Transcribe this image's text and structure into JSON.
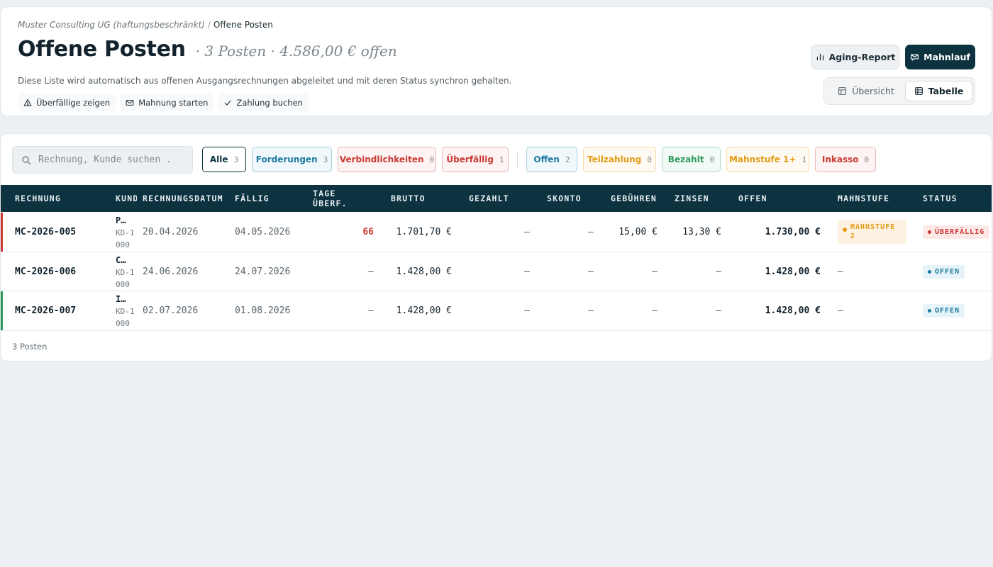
{
  "breadcrumb": {
    "company": "Muster Consulting UG (haftungsbeschränkt)",
    "separator": "/",
    "current": "Offene Posten"
  },
  "page": {
    "title": "Offene Posten",
    "summary": "· 3 Posten · 4.586,00 € offen",
    "description": "Diese Liste wird automatisch aus offenen Ausgangsrechnungen abgeleitet und mit deren Status synchron gehalten."
  },
  "quick_actions": [
    {
      "label": "Überfällige zeigen",
      "icon": "warning-icon"
    },
    {
      "label": "Mahnung starten",
      "icon": "mail-icon"
    },
    {
      "label": "Zahlung buchen",
      "icon": "check-icon"
    }
  ],
  "toolbar": {
    "aging_label": "Aging-Report",
    "mahnlauf_label": "Mahnlauf"
  },
  "view_toggle": {
    "overview_label": "Übersicht",
    "table_label": "Tabelle",
    "selected": "Tabelle"
  },
  "search": {
    "placeholder": "Rechnung, Kunde suchen .",
    "value": ""
  },
  "filters": [
    {
      "label": "Alle",
      "count": "3",
      "color": "#0d3340",
      "bg": "#ffffff",
      "active": true
    },
    {
      "label": "Forderungen",
      "count": "3",
      "color": "#1b7aa0",
      "bg": "#f1f8fb"
    },
    {
      "label": "Verbindlichkeiten",
      "count": "0",
      "color": "#c93a33",
      "bg": "#fdf3f3"
    },
    {
      "label": "Überfällig",
      "count": "1",
      "color": "#c93a33",
      "bg": "#fdf3f3"
    },
    {
      "label": "Offen",
      "count": "2",
      "color": "#1b7aa0",
      "bg": "#f1f8fb"
    },
    {
      "label": "Teilzahlung",
      "count": "0",
      "color": "#e39b17",
      "bg": "#fffaf1"
    },
    {
      "label": "Bezahlt",
      "count": "0",
      "color": "#2e9a5a",
      "bg": "#f2faf5"
    },
    {
      "label": "Mahnstufe 1+",
      "count": "1",
      "color": "#e39b17",
      "bg": "#fffaf1"
    },
    {
      "label": "Inkasso",
      "count": "0",
      "color": "#c93a33",
      "bg": "#fdf3f3"
    }
  ],
  "table": {
    "columns": [
      "RECHNUNG",
      "KUNDE",
      "RECHNUNGSDATUM",
      "FÄLLIG",
      "TAGE ÜBERF.",
      "BRUTTO",
      "GEZAHLT",
      "SKONTO",
      "GEBÜHREN",
      "ZINSEN",
      "OFFEN",
      "MAHNSTUFE",
      "STATUS"
    ],
    "rows": [
      {
        "rechnung": "MC-2026-005",
        "kunde": "P…",
        "kunde_nr": "KD-1000",
        "datum": "20.04.2026",
        "faellig": "04.05.2026",
        "tage": "66",
        "brutto": "1.701,70 €",
        "gezahlt": "–",
        "skonto": "–",
        "gebuehren": "15,00 €",
        "zinsen": "13,30 €",
        "offen": "1.730,00 €",
        "mahnstufe": "MAHNSTUFE 2",
        "status": "ÜBERFÄLLIG",
        "status_type": "overdue",
        "accent": "#c93a33"
      },
      {
        "rechnung": "MC-2026-006",
        "kunde": "C…",
        "kunde_nr": "KD-1000",
        "datum": "24.06.2026",
        "faellig": "24.07.2026",
        "tage": "–",
        "brutto": "1.428,00 €",
        "gezahlt": "–",
        "skonto": "–",
        "gebuehren": "–",
        "zinsen": "–",
        "offen": "1.428,00 €",
        "mahnstufe": "–",
        "status": "OFFEN",
        "status_type": "open",
        "accent": ""
      },
      {
        "rechnung": "MC-2026-007",
        "kunde": "I…",
        "kunde_nr": "KD-1000",
        "datum": "02.07.2026",
        "faellig": "01.08.2026",
        "tage": "–",
        "brutto": "1.428,00 €",
        "gezahlt": "–",
        "skonto": "–",
        "gebuehren": "–",
        "zinsen": "–",
        "offen": "1.428,00 €",
        "mahnstufe": "–",
        "status": "OFFEN",
        "status_type": "open",
        "accent": "#2e9a5a"
      }
    ]
  },
  "footer": {
    "count_label": "3 Posten"
  },
  "colors": {
    "primary": "#0d3340",
    "danger": "#c93a33",
    "warning": "#e39b17",
    "info": "#1b7aa0",
    "success": "#2e9a5a"
  }
}
